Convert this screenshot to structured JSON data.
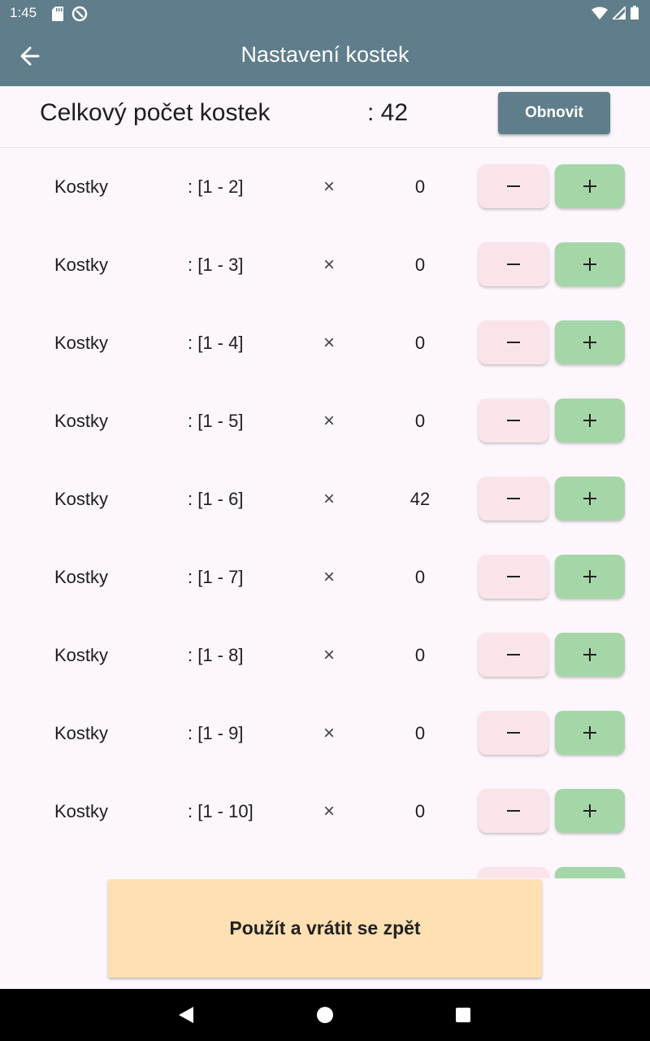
{
  "status": {
    "time": "1:45"
  },
  "app_bar": {
    "title": "Nastavení kostek"
  },
  "total": {
    "label": "Celkový počet kostek",
    "value": ": 42",
    "refresh_label": "Obnovit"
  },
  "rows": [
    {
      "label": "Kostky",
      "range": ": [1 - 2]",
      "times": "×",
      "count": "0"
    },
    {
      "label": "Kostky",
      "range": ": [1 - 3]",
      "times": "×",
      "count": "0"
    },
    {
      "label": "Kostky",
      "range": ": [1 - 4]",
      "times": "×",
      "count": "0"
    },
    {
      "label": "Kostky",
      "range": ": [1 - 5]",
      "times": "×",
      "count": "0"
    },
    {
      "label": "Kostky",
      "range": ": [1 - 6]",
      "times": "×",
      "count": "42"
    },
    {
      "label": "Kostky",
      "range": ": [1 - 7]",
      "times": "×",
      "count": "0"
    },
    {
      "label": "Kostky",
      "range": ": [1 - 8]",
      "times": "×",
      "count": "0"
    },
    {
      "label": "Kostky",
      "range": ": [1 - 9]",
      "times": "×",
      "count": "0"
    },
    {
      "label": "Kostky",
      "range": ": [1 - 10]",
      "times": "×",
      "count": "0"
    },
    {
      "label": "",
      "range": "",
      "times": "",
      "count": ""
    }
  ],
  "apply": {
    "label": "Použít a vrátit se zpět"
  },
  "colors": {
    "app_bar": "#5f7d8a",
    "minus": "#fae4ea",
    "plus": "#a5d6a7",
    "apply": "#ffe0b2"
  },
  "icons": {
    "status_left": [
      "sd-card-icon",
      "data-saver-icon"
    ],
    "status_right": [
      "wifi-icon",
      "signal-icon",
      "battery-icon"
    ],
    "back": "arrow-back-icon",
    "minus": "minus-icon",
    "plus": "plus-icon",
    "nav": [
      "nav-back-icon",
      "nav-home-icon",
      "nav-recents-icon"
    ]
  }
}
